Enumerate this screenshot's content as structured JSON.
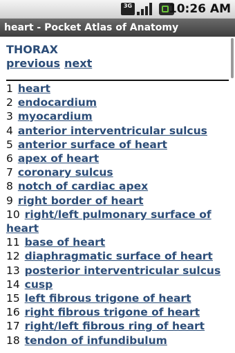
{
  "status_bar": {
    "network": "3G",
    "time": "10:26 AM"
  },
  "app": {
    "title": "heart - Pocket Atlas of Anatomy"
  },
  "page": {
    "section": "THORAX",
    "nav": {
      "previous": "previous",
      "next": "next"
    },
    "items": [
      {
        "num": "1",
        "label": "heart"
      },
      {
        "num": "2",
        "label": "endocardium"
      },
      {
        "num": "3",
        "label": "myocardium"
      },
      {
        "num": "4",
        "label": "anterior interventricular sulcus"
      },
      {
        "num": "5",
        "label": "anterior surface of heart"
      },
      {
        "num": "6",
        "label": "apex of heart"
      },
      {
        "num": "7",
        "label": "coronary sulcus"
      },
      {
        "num": "8",
        "label": "notch of cardiac apex"
      },
      {
        "num": "9",
        "label": "right border of heart"
      },
      {
        "num": "10",
        "label": "right/left pulmonary surface of heart"
      },
      {
        "num": "11",
        "label": "base of heart"
      },
      {
        "num": "12",
        "label": "diaphragmatic surface of heart"
      },
      {
        "num": "13",
        "label": "posterior interventricular sulcus"
      },
      {
        "num": "14",
        "label": "cusp"
      },
      {
        "num": "15",
        "label": "left fibrous trigone of heart"
      },
      {
        "num": "16",
        "label": "right fibrous trigone of heart"
      },
      {
        "num": "17",
        "label": "right/left fibrous ring of heart"
      },
      {
        "num": "18",
        "label": "tendon of infundibulum"
      }
    ]
  }
}
